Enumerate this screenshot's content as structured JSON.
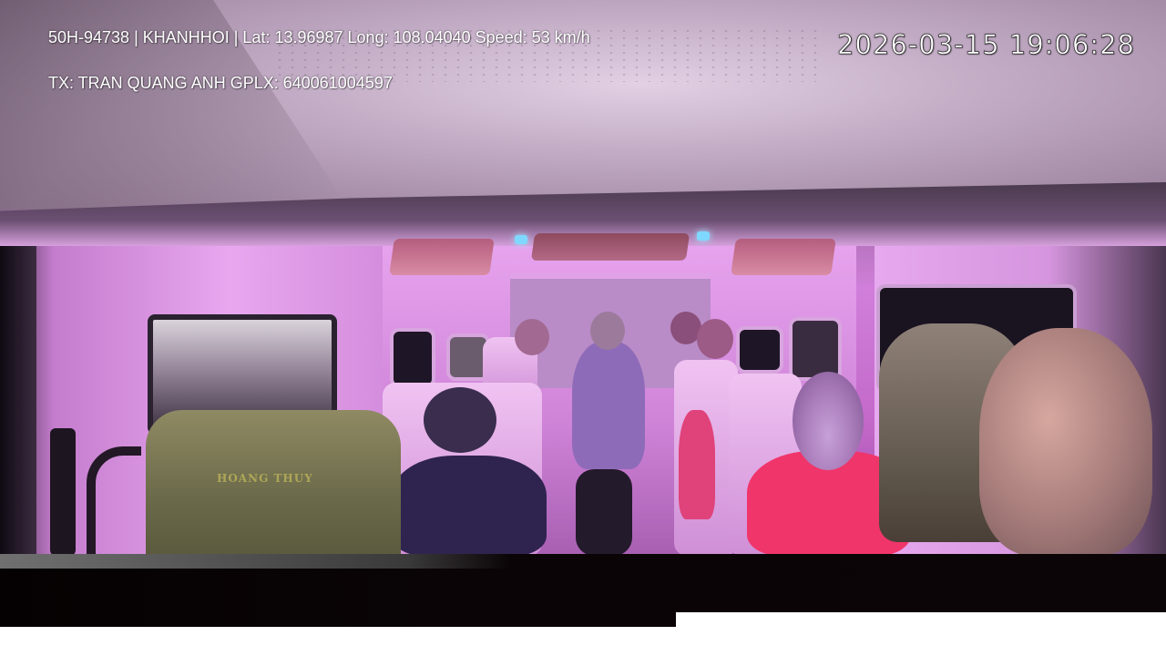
{
  "overlay": {
    "vehicle_info": "50H-94738 | KHANHHOI | Lat: 13.96987 Long: 108.04040 Speed: 53 km/h",
    "driver_info": "TX: TRAN QUANG ANH GPLX: 640061004597",
    "timestamp": "2026-03-15 19:06:28",
    "text_color": "#ffffff"
  },
  "scene": {
    "seat_logo_text": "HOANG THUY",
    "ambient_light_color": "#d07fda",
    "led_color": "#7fd8ff"
  }
}
